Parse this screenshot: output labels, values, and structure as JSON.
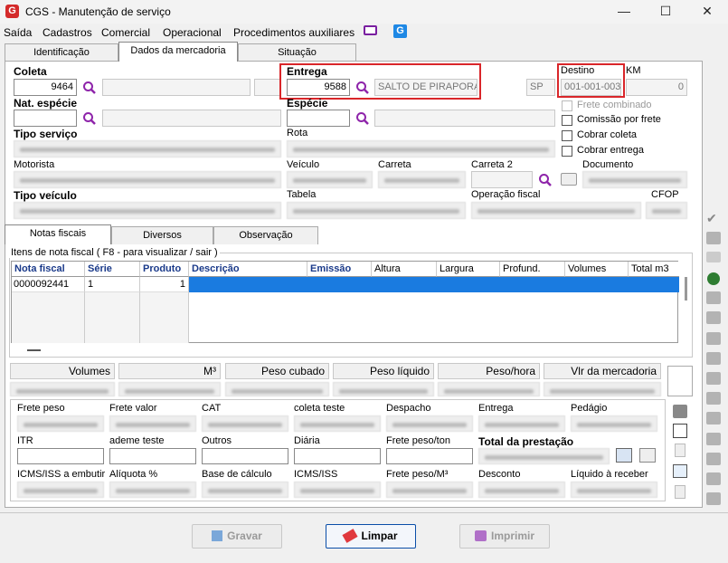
{
  "window": {
    "title": "CGS - Manutenção de serviço",
    "min": "—",
    "max": "☐",
    "close": "✕",
    "logo": "G"
  },
  "menu": [
    "Saída",
    "Cadastros",
    "Comercial",
    "Operacional",
    "Procedimentos auxiliares"
  ],
  "top_tabs": [
    "Identificação",
    "Dados da mercadoria",
    "Situação"
  ],
  "form": {
    "coleta_label": "Coleta",
    "coleta_value": "9464",
    "entrega_label": "Entrega",
    "entrega_value": "9588",
    "entrega_city": "SALTO DE PIRAPORA",
    "entrega_uf": "SP",
    "destino_label": "Destino",
    "destino_value": "001-001-003",
    "km_label": "KM",
    "km_value": "0",
    "nat_especie_label": "Nat. espécie",
    "especie_label": "Espécie",
    "tipo_servico_label": "Tipo serviço",
    "rota_label": "Rota",
    "motorista_label": "Motorista",
    "veiculo_label": "Veículo",
    "carreta_label": "Carreta",
    "carreta2_label": "Carreta 2",
    "documento_label": "Documento",
    "tipo_veiculo_label": "Tipo veículo",
    "tabela_label": "Tabela",
    "operacao_fiscal_label": "Operação fiscal",
    "cfop_label": "CFOP"
  },
  "checks": [
    "Frete combinado",
    "Comissão por frete",
    "Cobrar coleta",
    "Cobrar entrega"
  ],
  "sub_tabs": [
    "Notas fiscais",
    "Diversos",
    "Observação"
  ],
  "nf": {
    "group_title": "Itens de nota fiscal ( F8 - para visualizar / sair )",
    "headers": [
      "Nota fiscal",
      "Série",
      "Produto",
      "Descrição",
      "Emissão",
      "Altura",
      "Largura",
      "Profund.",
      "Volumes",
      "Total m3"
    ],
    "row": {
      "nota": "0000092441",
      "serie": "1",
      "produto": "1"
    }
  },
  "totals": [
    "Volumes",
    "M³",
    "Peso cubado",
    "Peso líquido",
    "Peso/hora",
    "Vlr da mercadoria"
  ],
  "freight_labels": {
    "r1": [
      "Frete peso",
      "Frete valor",
      "CAT",
      "coleta teste",
      "Despacho",
      "Entrega",
      "Pedágio"
    ],
    "r2": [
      "ITR",
      "ademe teste",
      "Outros",
      "Diária",
      "Frete peso/ton",
      "Total da prestação"
    ],
    "r3": [
      "ICMS/ISS a embutir",
      "Alíquota %",
      "Base de cálculo",
      "ICMS/ISS",
      "Frete peso/M³",
      "Desconto",
      "Líquido à receber"
    ]
  },
  "buttons": {
    "gravar": "Gravar",
    "limpar": "Limpar",
    "imprimir": "Imprimir"
  }
}
